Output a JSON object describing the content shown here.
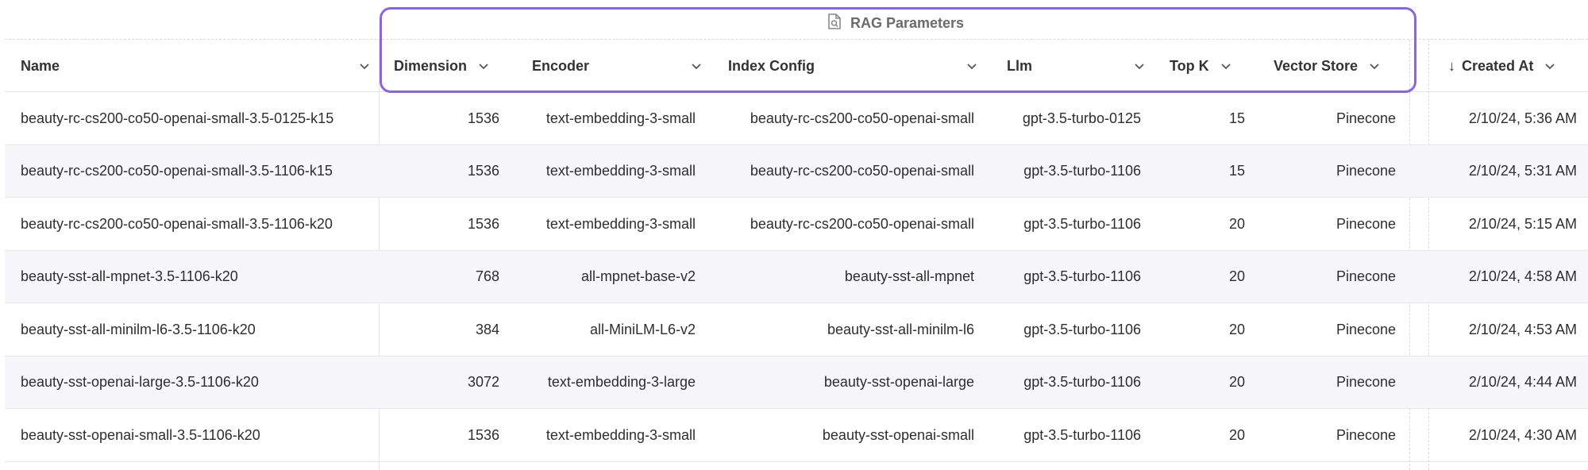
{
  "group": {
    "label": "RAG Parameters",
    "icon": "document-search-icon",
    "highlight_color": "#8a63e6"
  },
  "columns": {
    "name": "Name",
    "dimension": "Dimension",
    "encoder": "Encoder",
    "index_config": "Index Config",
    "llm": "Llm",
    "top_k": "Top K",
    "vector_store": "Vector Store",
    "created_at": "Created At",
    "created_at_sort": "↓"
  },
  "rows": [
    {
      "name": "beauty-rc-cs200-co50-openai-small-3.5-0125-k15",
      "dimension": "1536",
      "encoder": "text-embedding-3-small",
      "index_config": "beauty-rc-cs200-co50-openai-small",
      "llm": "gpt-3.5-turbo-0125",
      "top_k": "15",
      "vector_store": "Pinecone",
      "created_at": "2/10/24, 5:36 AM"
    },
    {
      "name": "beauty-rc-cs200-co50-openai-small-3.5-1106-k15",
      "dimension": "1536",
      "encoder": "text-embedding-3-small",
      "index_config": "beauty-rc-cs200-co50-openai-small",
      "llm": "gpt-3.5-turbo-1106",
      "top_k": "15",
      "vector_store": "Pinecone",
      "created_at": "2/10/24, 5:31 AM"
    },
    {
      "name": "beauty-rc-cs200-co50-openai-small-3.5-1106-k20",
      "dimension": "1536",
      "encoder": "text-embedding-3-small",
      "index_config": "beauty-rc-cs200-co50-openai-small",
      "llm": "gpt-3.5-turbo-1106",
      "top_k": "20",
      "vector_store": "Pinecone",
      "created_at": "2/10/24, 5:15 AM"
    },
    {
      "name": "beauty-sst-all-mpnet-3.5-1106-k20",
      "dimension": "768",
      "encoder": "all-mpnet-base-v2",
      "index_config": "beauty-sst-all-mpnet",
      "llm": "gpt-3.5-turbo-1106",
      "top_k": "20",
      "vector_store": "Pinecone",
      "created_at": "2/10/24, 4:58 AM"
    },
    {
      "name": "beauty-sst-all-minilm-l6-3.5-1106-k20",
      "dimension": "384",
      "encoder": "all-MiniLM-L6-v2",
      "index_config": "beauty-sst-all-minilm-l6",
      "llm": "gpt-3.5-turbo-1106",
      "top_k": "20",
      "vector_store": "Pinecone",
      "created_at": "2/10/24, 4:53 AM"
    },
    {
      "name": "beauty-sst-openai-large-3.5-1106-k20",
      "dimension": "3072",
      "encoder": "text-embedding-3-large",
      "index_config": "beauty-sst-openai-large",
      "llm": "gpt-3.5-turbo-1106",
      "top_k": "20",
      "vector_store": "Pinecone",
      "created_at": "2/10/24, 4:44 AM"
    },
    {
      "name": "beauty-sst-openai-small-3.5-1106-k20",
      "dimension": "1536",
      "encoder": "text-embedding-3-small",
      "index_config": "beauty-sst-openai-small",
      "llm": "gpt-3.5-turbo-1106",
      "top_k": "20",
      "vector_store": "Pinecone",
      "created_at": "2/10/24, 4:30 AM"
    }
  ]
}
